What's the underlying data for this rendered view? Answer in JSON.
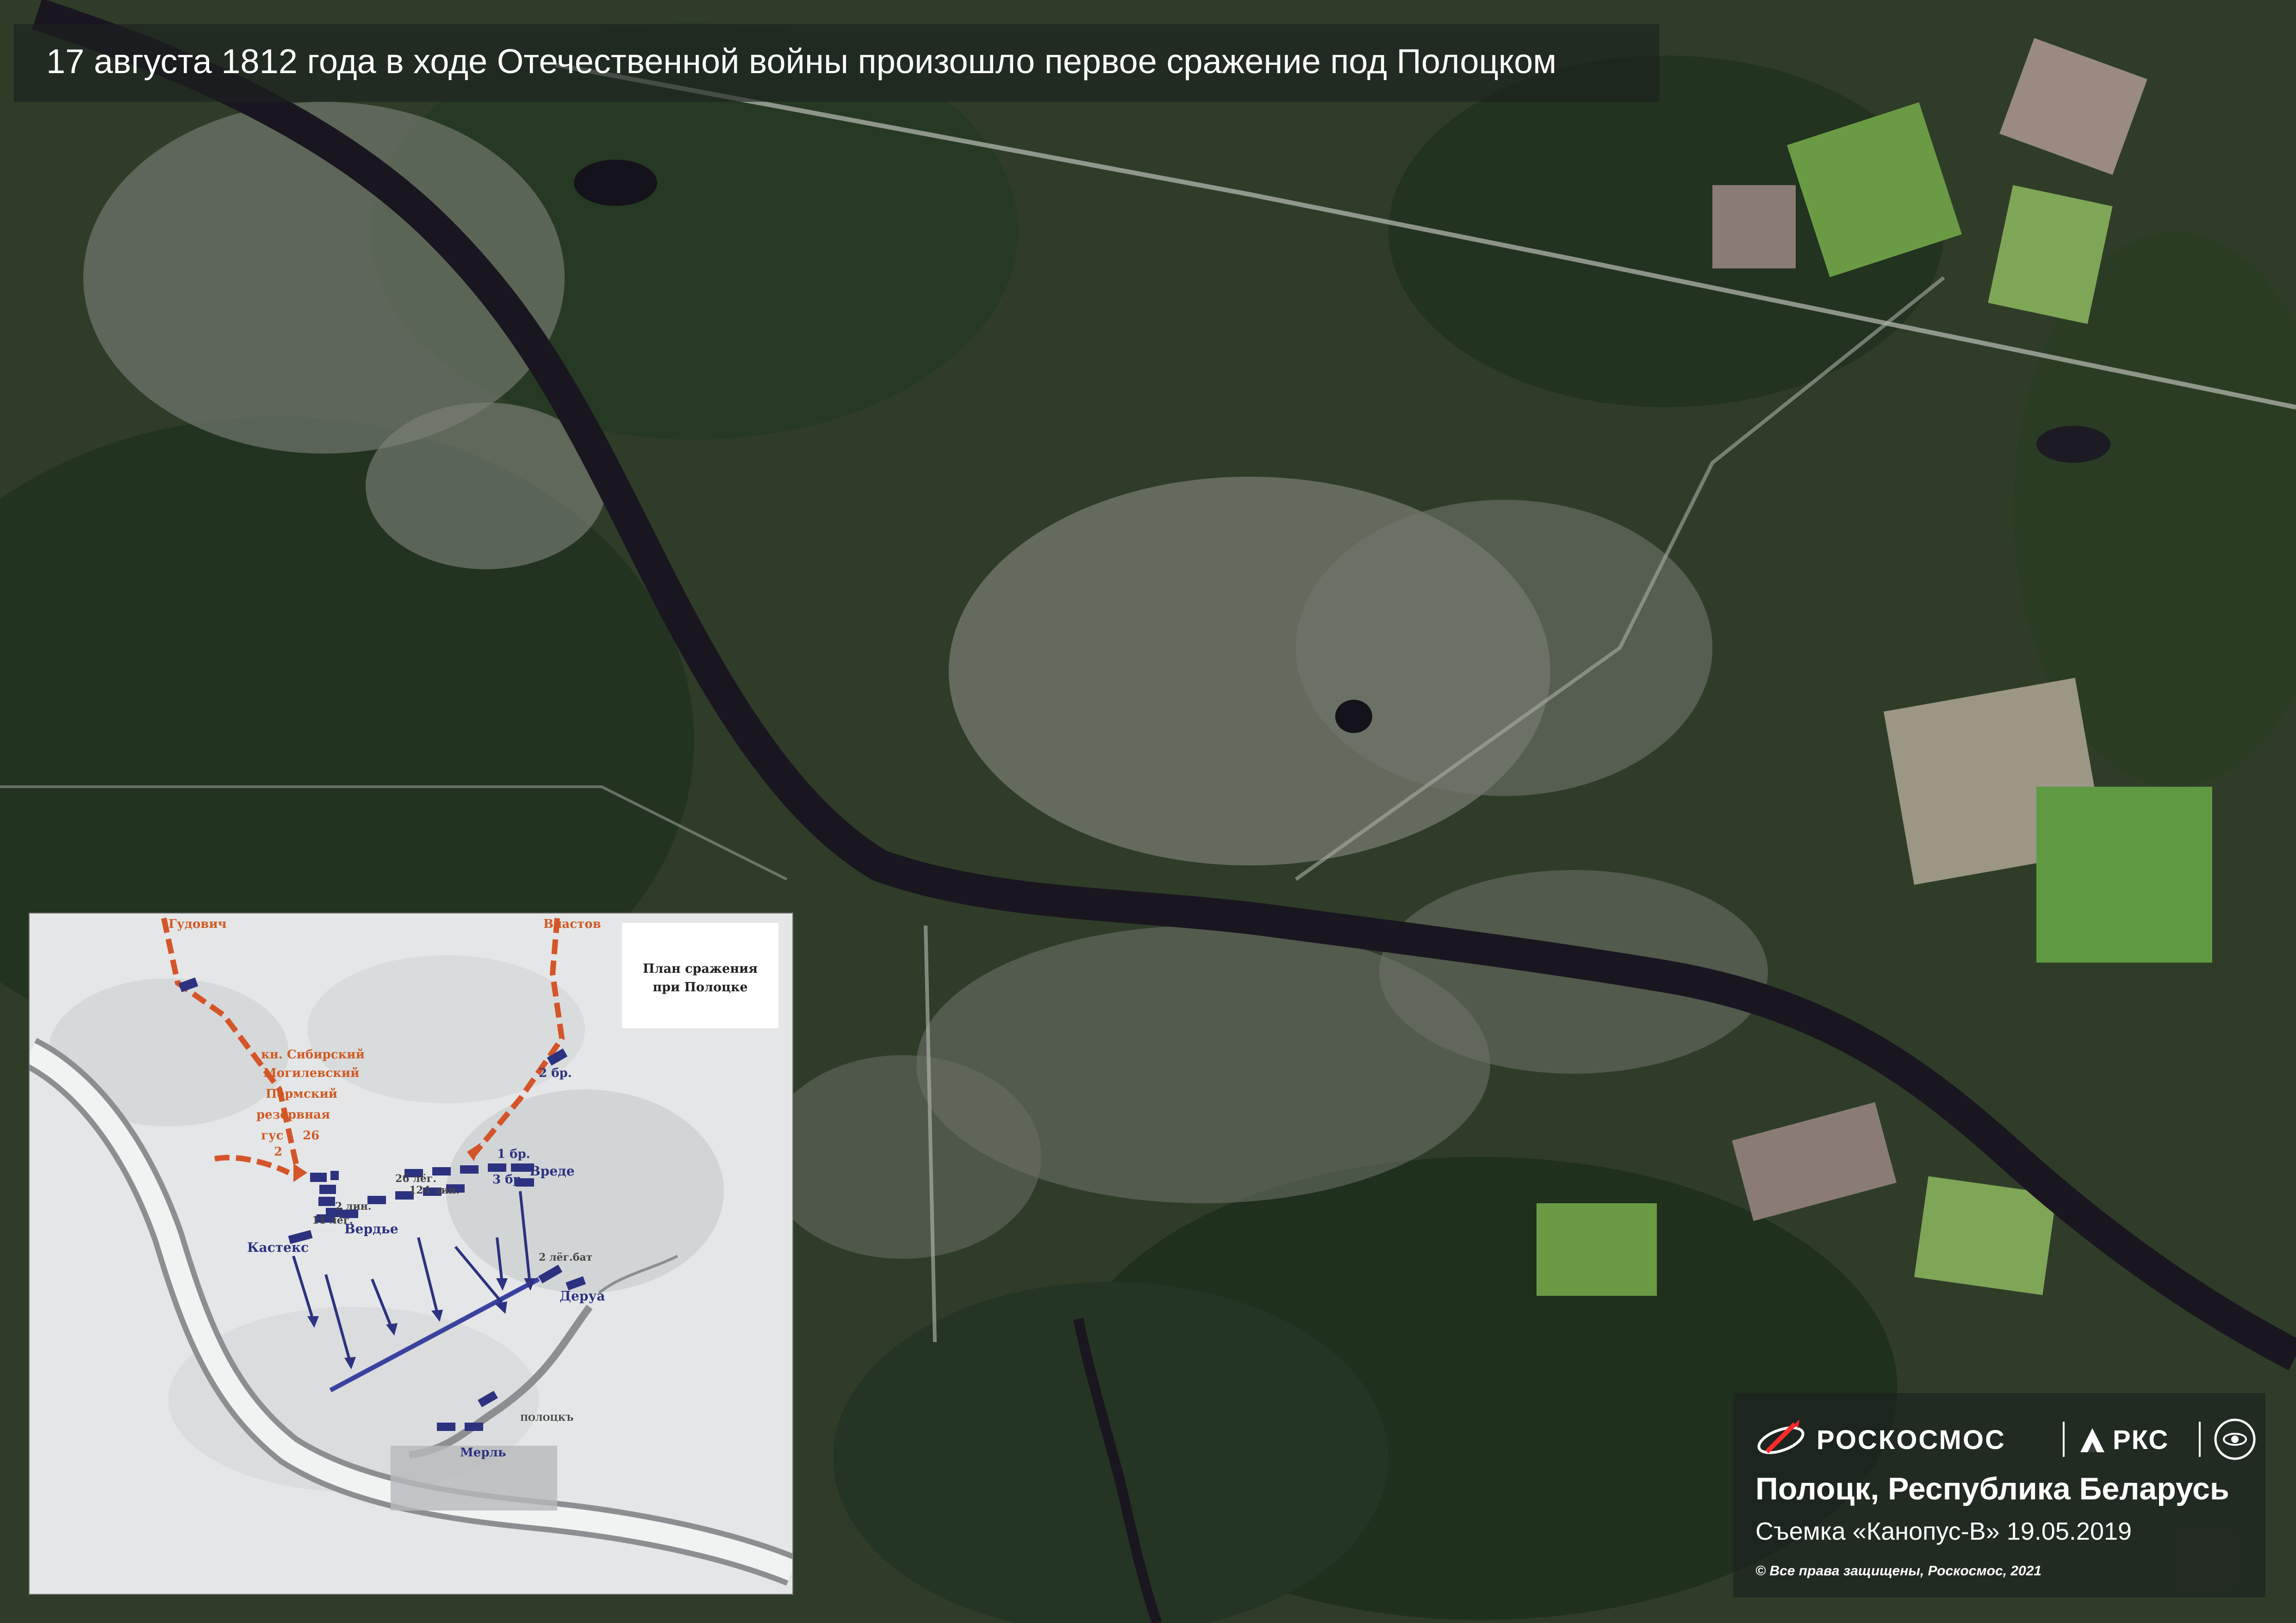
{
  "header": {
    "title": "17 августа 1812 года в ходе Отечественной войны произошло первое сражение под Полоцком"
  },
  "inset_map": {
    "title_line1": "План сражения",
    "title_line2": "при Полоцке",
    "labels": {
      "gudovich": "Гудович",
      "vlastov": "Властов",
      "sibirsky": "кн. Сибирский",
      "mogilevsky": "Могилевский",
      "perm": "Пермский",
      "reserve": "резервная",
      "gus": "гус",
      "num2": "2",
      "num26": "26",
      "br2": "2 бр.",
      "br1": "1 бр.",
      "br3": "3 бр.",
      "vrede": "Вреде",
      "leg26": "26 лёг.",
      "lin124": "124 лин.",
      "lin2": "2 лин.",
      "leg11": "11 лёг.",
      "verdye": "Вердье",
      "kasteks": "Кастекс",
      "bat2leg": "2 лёг.бат",
      "derua": "Деруа",
      "merl": "Мерль",
      "polotsk": "ПОЛОЦКЪ"
    }
  },
  "info_panel": {
    "brand_roscosmos": "РОСКОСМОС",
    "brand_rks": "РКС",
    "location": "Полоцк, Республика Беларусь",
    "capture": "Съемка «Канопус-В» 19.05.2019",
    "copyright": "© Все права защищены, Роскосмос, 2021"
  },
  "colors": {
    "river": "#1a1620",
    "forest": "#26391f",
    "urban": "#8a8f86",
    "field_light": "#7fa557",
    "red_arrow": "#d4552a",
    "blue_unit": "#2c3280"
  },
  "icons": [
    "roscosmos-logo-icon",
    "rks-logo-icon",
    "emblem-icon",
    "movement-arrow-icon"
  ]
}
